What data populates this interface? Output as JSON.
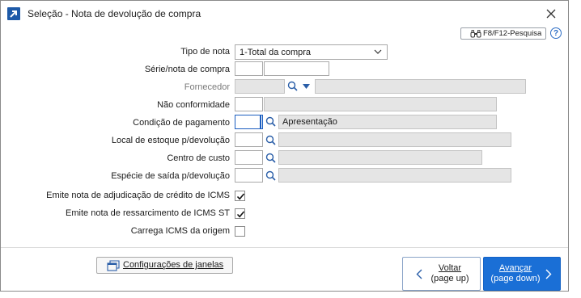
{
  "window": {
    "title": "Seleção - Nota de devolução de compra",
    "search_button": "F8/F12-Pesquisa",
    "help": "?"
  },
  "form": {
    "tipo_nota": {
      "label": "Tipo de nota",
      "value": "1-Total da compra"
    },
    "serie_nota": {
      "label": "Série/nota de compra",
      "serie": "",
      "nota": ""
    },
    "fornecedor": {
      "label": "Fornecedor",
      "code": "",
      "name": ""
    },
    "nao_conformidade": {
      "label": "Não conformidade",
      "code": "",
      "desc": ""
    },
    "condicao_pagamento": {
      "label": "Condição de pagamento",
      "code": "",
      "desc": "Apresentação"
    },
    "local_estoque": {
      "label": "Local de estoque p/devolução",
      "code": "",
      "desc": ""
    },
    "centro_custo": {
      "label": "Centro de custo",
      "code": "",
      "desc": ""
    },
    "especie_saida": {
      "label": "Espécie de saída p/devolução",
      "code": "",
      "desc": ""
    },
    "emite_adjudicacao": {
      "label": "Emite nota de adjudicação de crédito de ICMS",
      "checked": true
    },
    "emite_ressarcimento": {
      "label": "Emite nota de ressarcimento de ICMS ST",
      "checked": true
    },
    "carrega_icms": {
      "label": "Carrega ICMS da origem",
      "checked": false
    }
  },
  "footer": {
    "config_button": "Configurações de janelas",
    "back": {
      "line1": "Voltar",
      "line2": "(page up)"
    },
    "next": {
      "line1": "Avançar",
      "line2": "(page down)"
    }
  },
  "colors": {
    "accent": "#1a6fd6",
    "readonly_bg": "#e5e5e5",
    "icon_blue": "#1e5aa8"
  },
  "icons": [
    "app-arrow-icon",
    "close-icon",
    "binoculars-icon",
    "help-icon",
    "search-icon",
    "dropdown-arrow-icon",
    "chevron-down-icon",
    "check-icon",
    "windows-icon",
    "chevron-left-icon",
    "chevron-right-icon"
  ]
}
